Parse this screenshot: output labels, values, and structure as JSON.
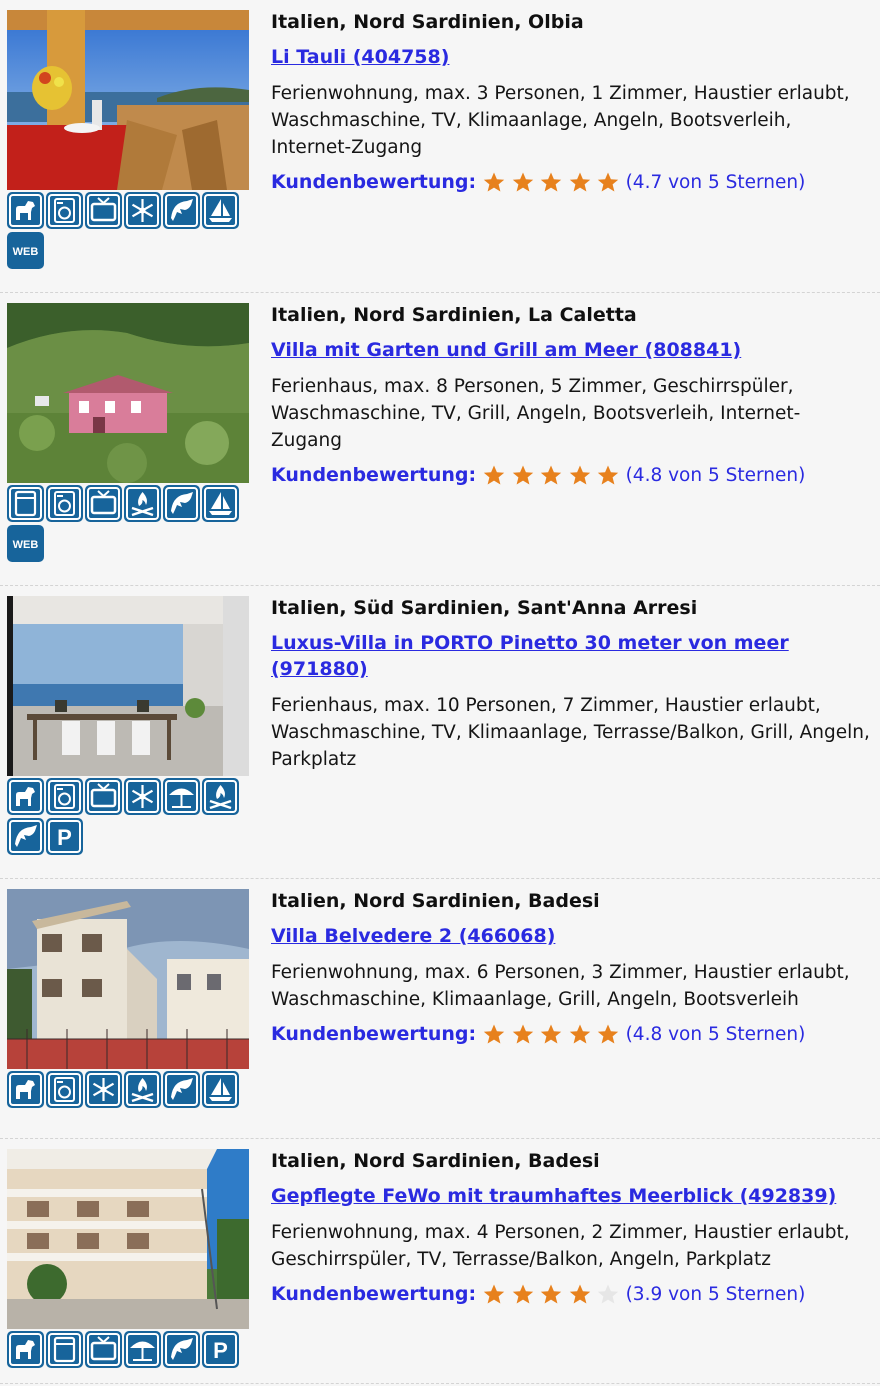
{
  "rating_label": "Kundenbewertung:",
  "listings": [
    {
      "location": "Italien, Nord Sardinien, Olbia",
      "title": "Li Tauli (404758)",
      "description": "Ferienwohnung, max. 3 Personen, 1 Zimmer, Haustier erlaubt, Waschmaschine, TV, Klimaanlage, Angeln, Bootsverleih, Internet-Zugang",
      "rating_text": "(4.7 von 5 Sternen)",
      "stars": 5,
      "photo_alt": "terrace-sea-view-photo",
      "icons": [
        "pet-icon",
        "washing-machine-icon",
        "tv-icon",
        "air-conditioning-icon",
        "fishing-icon",
        "boat-rental-icon",
        "internet-icon"
      ]
    },
    {
      "location": "Italien, Nord Sardinien, La Caletta",
      "title": "Villa mit Garten und Grill am Meer (808841)",
      "description": "Ferienhaus, max. 8 Personen, 5 Zimmer, Geschirrspüler, Waschmaschine, TV, Grill, Angeln, Bootsverleih, Internet-Zugang",
      "rating_text": "(4.8 von 5 Sternen)",
      "stars": 5,
      "photo_alt": "pink-villa-photo",
      "icons": [
        "dishwasher-icon",
        "washing-machine-icon",
        "tv-icon",
        "grill-icon",
        "fishing-icon",
        "boat-rental-icon",
        "internet-icon"
      ]
    },
    {
      "location": "Italien, Süd Sardinien, Sant'Anna Arresi",
      "title": "Luxus-Villa in PORTO Pinetto 30 meter von meer (971880)",
      "description": "Ferienhaus, max. 10 Personen, 7 Zimmer, Haustier erlaubt, Waschmaschine, TV, Klimaanlage, Terrasse/Balkon, Grill, Angeln, Parkplatz",
      "rating_text": "",
      "stars": 0,
      "photo_alt": "veranda-sea-view-photo",
      "icons": [
        "pet-icon",
        "washing-machine-icon",
        "tv-icon",
        "air-conditioning-icon",
        "terrace-icon",
        "grill-icon",
        "fishing-icon",
        "parking-icon"
      ]
    },
    {
      "location": "Italien, Nord Sardinien, Badesi",
      "title": "Villa Belvedere 2 (466068)",
      "description": "Ferienwohnung, max. 6 Personen, 3 Zimmer, Haustier erlaubt, Waschmaschine, Klimaanlage, Grill, Angeln, Bootsverleih",
      "rating_text": "(4.8 von 5 Sternen)",
      "stars": 5,
      "photo_alt": "villa-building-photo",
      "icons": [
        "pet-icon",
        "washing-machine-icon",
        "air-conditioning-icon",
        "grill-icon",
        "fishing-icon",
        "boat-rental-icon"
      ]
    },
    {
      "location": "Italien, Nord Sardinien, Badesi",
      "title": "Gepflegte FeWo mit traumhaftes Meerblick (492839)",
      "description": "Ferienwohnung, max. 4 Personen, 2 Zimmer, Haustier erlaubt, Geschirrspüler, TV, Terrasse/Balkon, Angeln, Parkplatz",
      "rating_text": "(3.9 von 5 Sternen)",
      "stars": 4,
      "photo_alt": "apartment-building-photo",
      "icons": [
        "pet-icon",
        "dishwasher-icon",
        "tv-icon",
        "terrace-icon",
        "fishing-icon",
        "parking-icon"
      ]
    }
  ]
}
